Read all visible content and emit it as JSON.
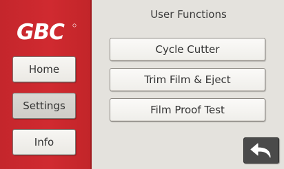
{
  "brand": {
    "logo_text": "GBC",
    "logo_color": "#ffffff",
    "sidebar_color": "#c4262c"
  },
  "sidebar": {
    "items": [
      {
        "label": "Home",
        "active": false
      },
      {
        "label": "Settings",
        "active": true
      },
      {
        "label": "Info",
        "active": false
      }
    ]
  },
  "main": {
    "title": "User Functions",
    "buttons": [
      {
        "label": "Cycle Cutter"
      },
      {
        "label": "Trim Film & Eject"
      },
      {
        "label": "Film Proof Test"
      }
    ],
    "back_icon": "back-arrow-icon"
  }
}
